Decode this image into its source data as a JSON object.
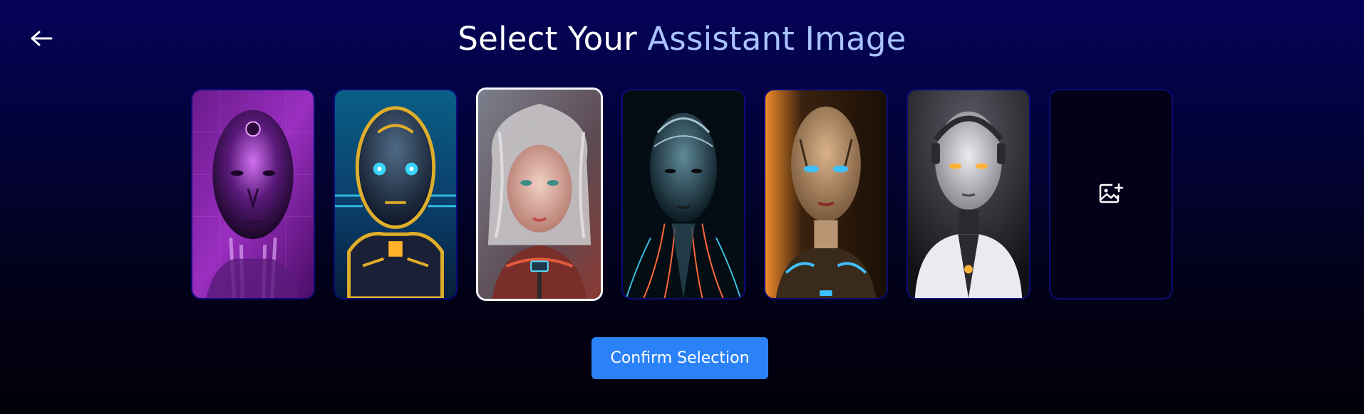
{
  "header": {
    "back_icon": "arrow-left-icon",
    "title_prefix": "Select Your ",
    "title_accent": "Assistant Image"
  },
  "gallery": {
    "items": [
      {
        "name": "purple-robot",
        "selected": false,
        "palette": [
          "#3a0a52",
          "#b23cd6",
          "#e06df0"
        ]
      },
      {
        "name": "gold-robot",
        "selected": false,
        "palette": [
          "#063a5a",
          "#d8a61c",
          "#35d7ff"
        ]
      },
      {
        "name": "silver-haired-android",
        "selected": true,
        "palette": [
          "#5b5e6a",
          "#d9c3bb",
          "#e3553c"
        ]
      },
      {
        "name": "wired-cyborg",
        "selected": false,
        "palette": [
          "#071a24",
          "#3e6c7d",
          "#ff6a3a"
        ]
      },
      {
        "name": "bronze-android",
        "selected": false,
        "palette": [
          "#2a1b0c",
          "#c9a27c",
          "#3fc0ff"
        ]
      },
      {
        "name": "white-android",
        "selected": false,
        "palette": [
          "#2c2c34",
          "#e9e9ef",
          "#ffb23a"
        ]
      }
    ],
    "upload_icon": "image-plus-icon"
  },
  "actions": {
    "confirm_label": "Confirm Selection"
  },
  "colors": {
    "background_top": "#04035a",
    "background_bottom": "#010008",
    "title_accent": "#a9c3ff",
    "card_border": "#0b0b7a",
    "selected_border": "#f4f6ff",
    "primary_button": "#2b81f8"
  }
}
